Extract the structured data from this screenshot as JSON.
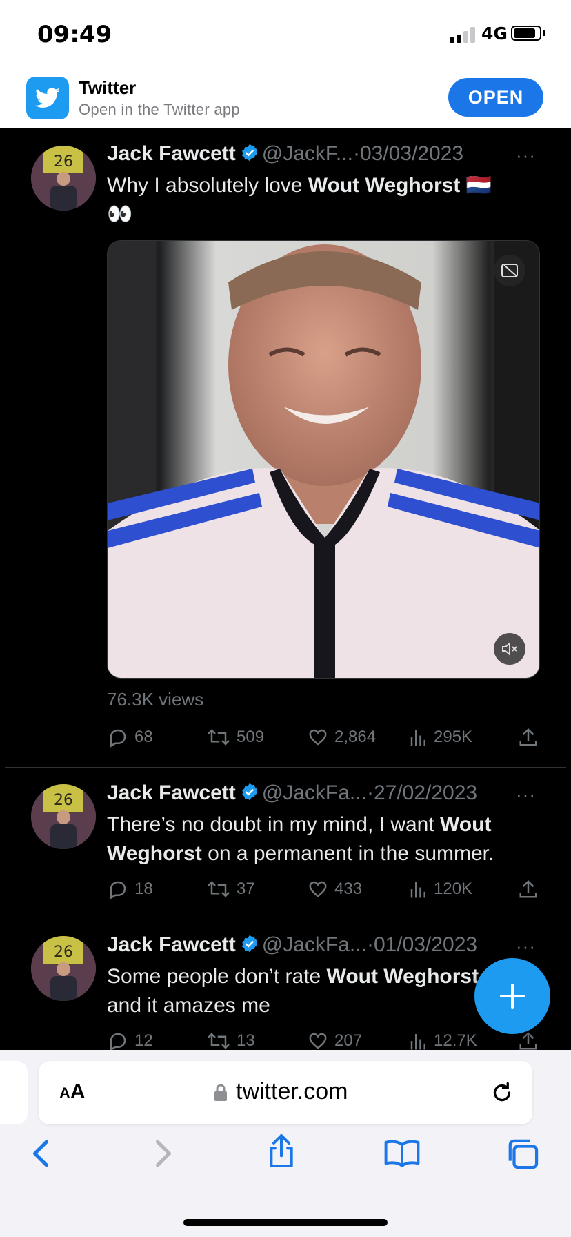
{
  "status_bar": {
    "time": "09:49",
    "network": "4G",
    "signal_bars": 2,
    "battery_level": 0.8
  },
  "app_banner": {
    "name": "Twitter",
    "subtitle": "Open in the Twitter app",
    "open_label": "OPEN",
    "accent": "#1d9bf0"
  },
  "tweets": [
    {
      "author": "Jack Fawcett",
      "handle": "@JackF...",
      "date": "03/03/2023",
      "text_parts": [
        "Why I absolutely love ",
        "Wout Weghorst",
        " 🇳🇱"
      ],
      "text_line2": "👀",
      "views": "76.3K views",
      "replies": "68",
      "retweets": "509",
      "likes": "2,864",
      "impressions": "295K"
    },
    {
      "author": "Jack Fawcett",
      "handle": "@JackFa...",
      "date": "27/02/2023",
      "text_line1_parts": [
        "There’s no doubt in my mind, I want ",
        "Wout"
      ],
      "text_line2_parts": [
        "Weghorst",
        " on a permanent in the summer."
      ],
      "replies": "18",
      "retweets": "37",
      "likes": "433",
      "impressions": "120K"
    },
    {
      "author": "Jack Fawcett",
      "handle": "@JackFa...",
      "date": "01/03/2023",
      "text_line1_parts": [
        "Some people don’t rate ",
        "Wout Weghorst"
      ],
      "text_line2": "and it amazes me",
      "replies": "12",
      "retweets": "13",
      "likes": "207",
      "impressions": "12.7K"
    }
  ],
  "safari": {
    "aa_label_big": "A",
    "aa_label_small": "A",
    "url": "twitter.com",
    "text_size_label": "AA"
  },
  "separator": "·",
  "more": "···"
}
